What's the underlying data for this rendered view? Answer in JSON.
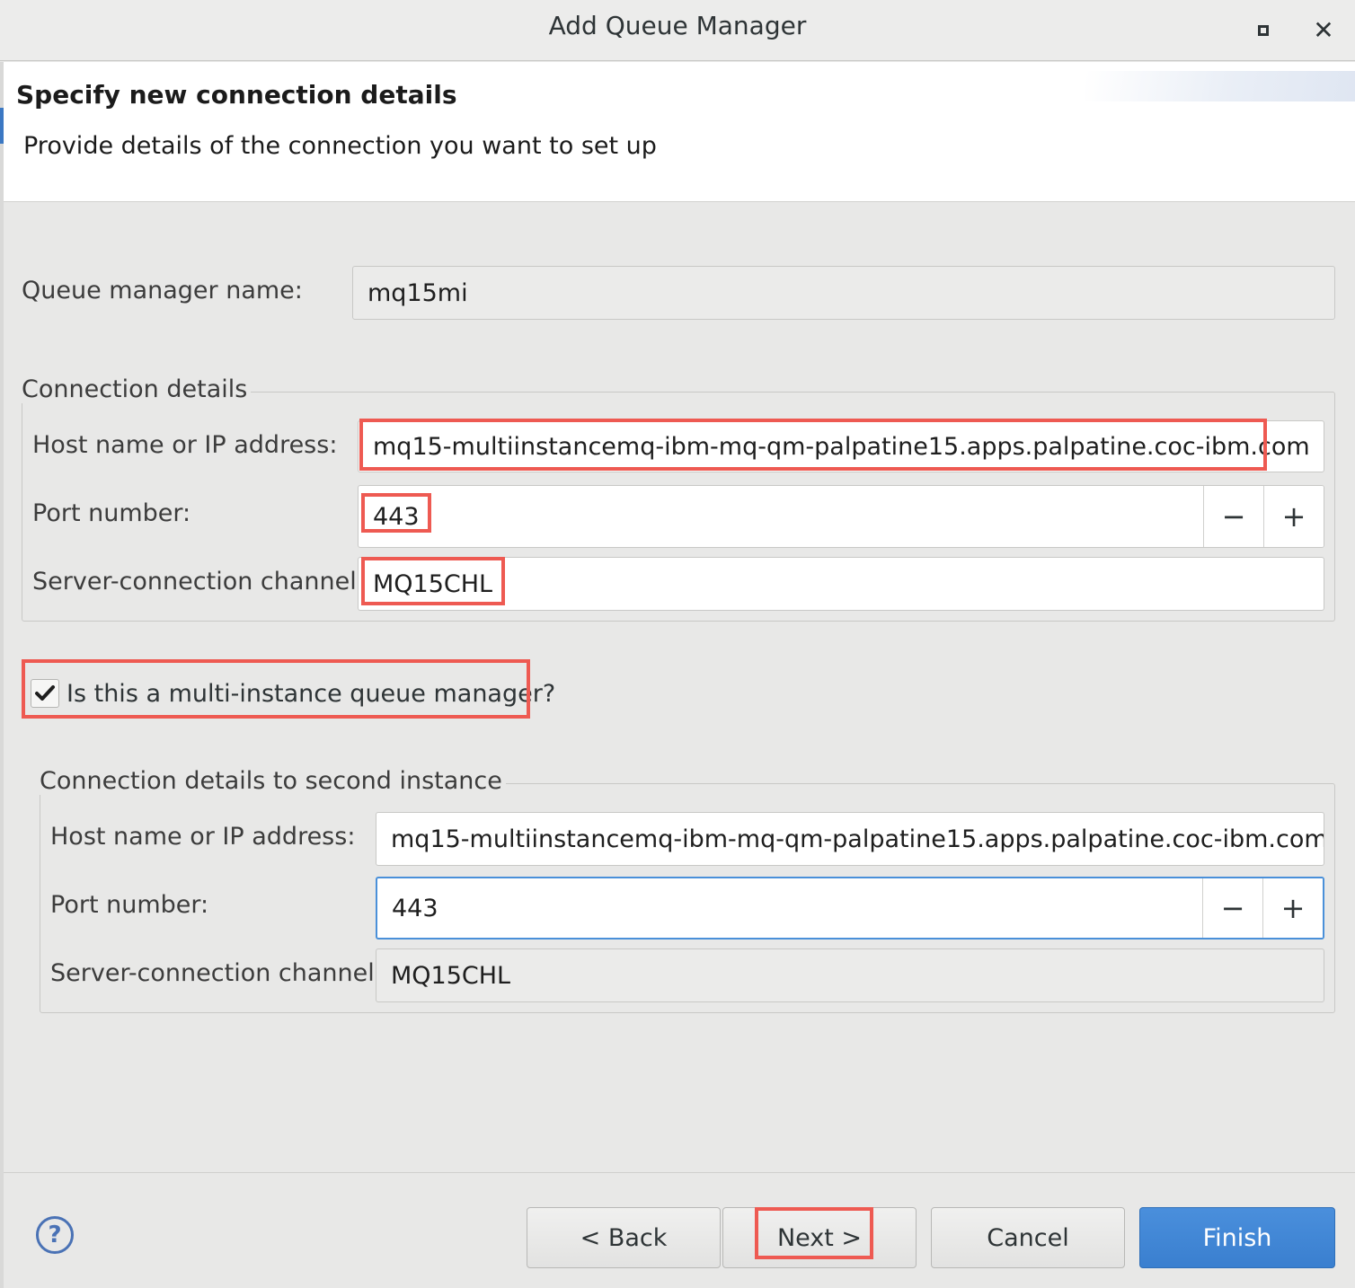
{
  "window": {
    "title": "Add Queue Manager"
  },
  "header": {
    "title": "Specify new connection details",
    "subtitle": "Provide details of the connection you want to set up"
  },
  "queue_manager": {
    "label": "Queue manager name:",
    "value": "mq15mi"
  },
  "connection_details": {
    "legend": "Connection details",
    "host_label": "Host name or IP address:",
    "host_value": "mq15-multiinstancemq-ibm-mq-qm-palpatine15.apps.palpatine.coc-ibm.com",
    "port_label": "Port number:",
    "port_value": "443",
    "channel_label": "Server-connection channel:",
    "channel_value": "MQ15CHL"
  },
  "multi_instance": {
    "label": "Is this a multi-instance queue manager?",
    "checked": true
  },
  "second_instance": {
    "legend": "Connection details to second instance",
    "host_label": "Host name or IP address:",
    "host_value": "mq15-multiinstancemq-ibm-mq-qm-palpatine15.apps.palpatine.coc-ibm.com",
    "port_label": "Port number:",
    "port_value": "443",
    "channel_label": "Server-connection channel:",
    "channel_value": "MQ15CHL"
  },
  "spinner": {
    "decrement": "−",
    "increment": "+"
  },
  "buttons": {
    "back": "< Back",
    "next": "Next >",
    "cancel": "Cancel",
    "finish": "Finish",
    "help": "?"
  },
  "colors": {
    "highlight": "#ee5a52",
    "accent": "#3a7fcf",
    "focus": "#4a90d9"
  }
}
